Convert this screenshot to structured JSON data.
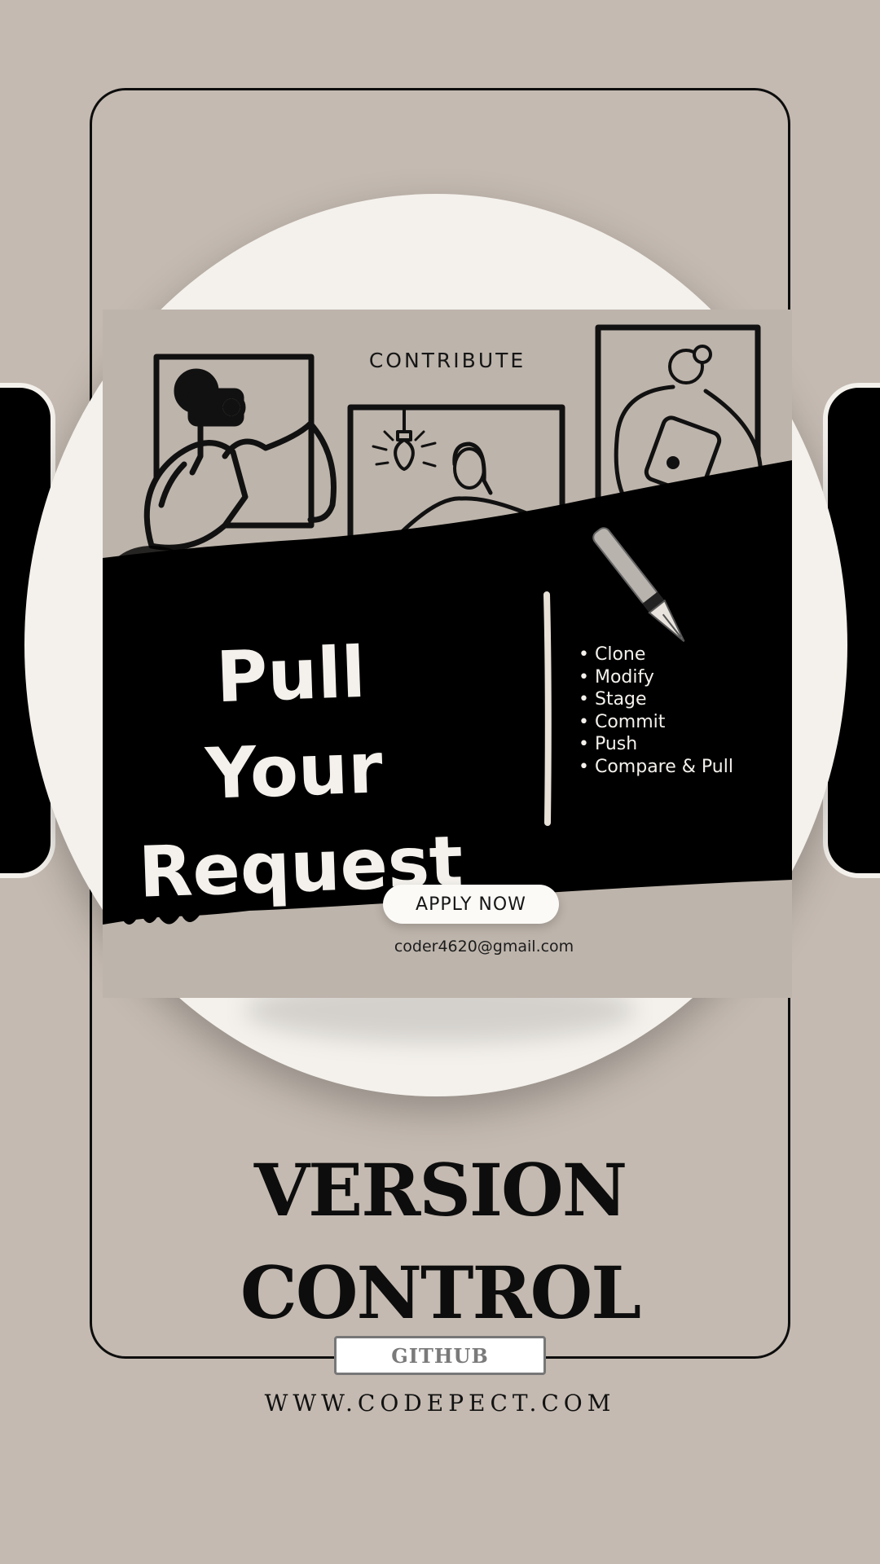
{
  "poster": {
    "tagline": "CONTRIBUTE",
    "headline_line1": "Pull Your",
    "headline_line2": "Request",
    "steps": [
      "Clone",
      "Modify",
      "Stage",
      "Commit",
      "Push",
      "Compare & Pull"
    ],
    "apply_label": "APPLY NOW",
    "email": "coder4620@gmail.com"
  },
  "title_line1": "VERSION",
  "title_line2": "CONTROL",
  "badge_label": "GITHUB",
  "website": "WWW.CODEPECT.COM",
  "colors": {
    "background": "#c4bab1",
    "poster_background": "#bdb4ab",
    "plate": "#f4f1ec",
    "ink": "#0d0d0d",
    "badge_text": "#7a7a7a"
  },
  "icons": [
    "photographer-illustration",
    "lightbulb-person-illustration",
    "woman-with-tablet-illustration",
    "fountain-pen-icon"
  ]
}
